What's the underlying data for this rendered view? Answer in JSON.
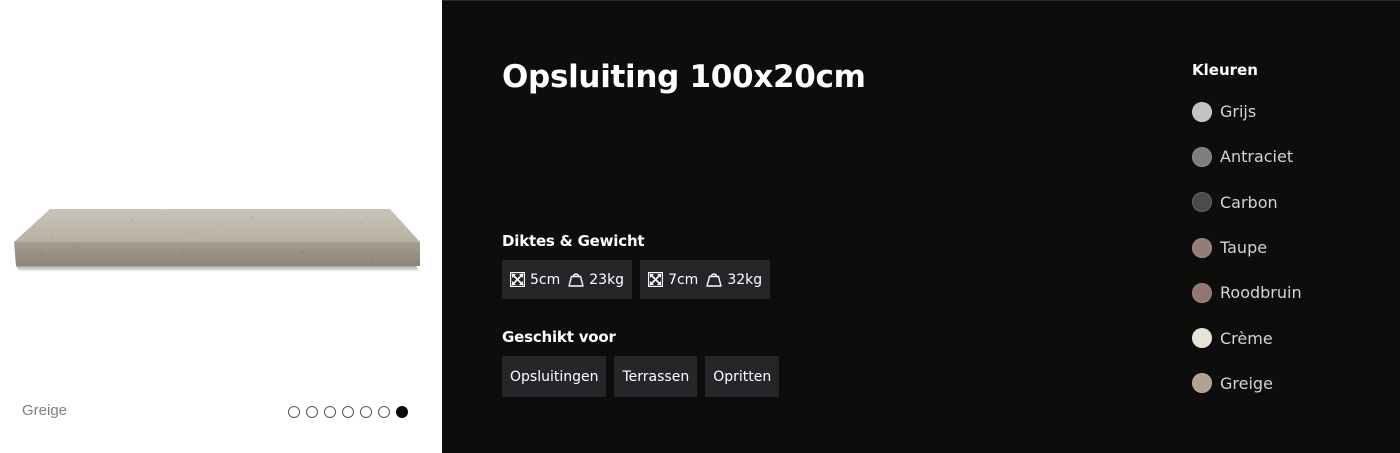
{
  "gallery": {
    "caption": "Greige",
    "dots": [
      false,
      false,
      false,
      false,
      false,
      false,
      true
    ]
  },
  "product": {
    "title": "Opsluiting 100x20cm"
  },
  "thickness": {
    "heading": "Diktes & Gewicht",
    "options": [
      {
        "thickness": "5cm",
        "weight": "23kg"
      },
      {
        "thickness": "7cm",
        "weight": "32kg"
      }
    ],
    "icons": {
      "size": "expand-arrows-icon",
      "weight": "weight-icon"
    }
  },
  "suitable": {
    "heading": "Geschikt voor",
    "items": [
      "Opsluitingen",
      "Terrassen",
      "Opritten"
    ]
  },
  "colors": {
    "heading": "Kleuren",
    "items": [
      {
        "label": "Grijs",
        "hex": "#c3c3c3"
      },
      {
        "label": "Antraciet",
        "hex": "#7d7d7b"
      },
      {
        "label": "Carbon",
        "hex": "#4b4b4b"
      },
      {
        "label": "Taupe",
        "hex": "#917e78"
      },
      {
        "label": "Roodbruin",
        "hex": "#8e7870"
      },
      {
        "label": "Crème",
        "hex": "#e7e3d6"
      },
      {
        "label": "Greige",
        "hex": "#aea293"
      }
    ]
  }
}
